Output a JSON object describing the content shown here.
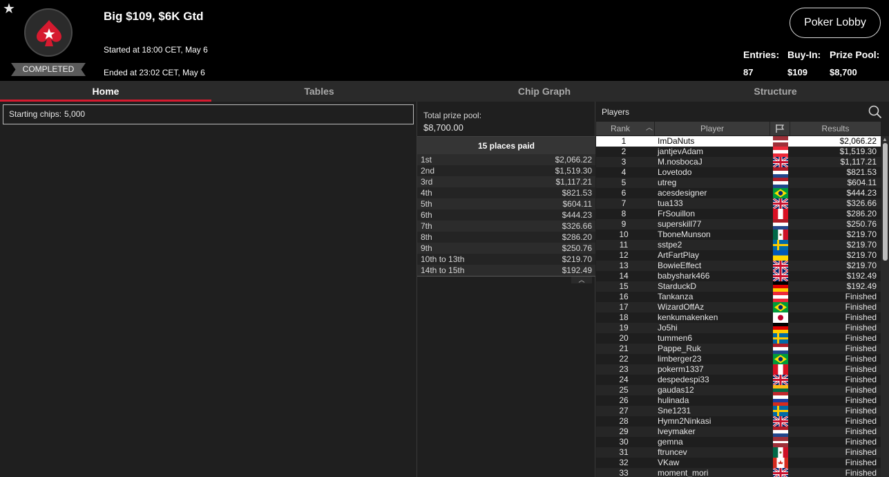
{
  "tournament": {
    "title": "Big $109, $6K Gtd",
    "started": "Started at 18:00 CET, May 6",
    "ended": "Ended at 23:02 CET, May 6",
    "status": "COMPLETED",
    "lobby_button": "Poker Lobby",
    "stats": {
      "entries_label": "Entries:",
      "entries": "87",
      "buyin_label": "Buy-In:",
      "buyin": "$109",
      "prizepool_label": "Prize Pool:",
      "prizepool": "$8,700"
    }
  },
  "tabs": [
    "Home",
    "Tables",
    "Chip Graph",
    "Structure"
  ],
  "active_tab": "Home",
  "home": {
    "starting_chips_label": "Starting chips:",
    "starting_chips": "5,000"
  },
  "prize": {
    "total_label": "Total prize pool:",
    "total_value": "$8,700.00",
    "places_paid": "15 places paid",
    "payouts": [
      {
        "place": "1st",
        "amount": "$2,066.22"
      },
      {
        "place": "2nd",
        "amount": "$1,519.30"
      },
      {
        "place": "3rd",
        "amount": "$1,117.21"
      },
      {
        "place": "4th",
        "amount": "$821.53"
      },
      {
        "place": "5th",
        "amount": "$604.11"
      },
      {
        "place": "6th",
        "amount": "$444.23"
      },
      {
        "place": "7th",
        "amount": "$326.66"
      },
      {
        "place": "8th",
        "amount": "$286.20"
      },
      {
        "place": "9th",
        "amount": "$250.76"
      },
      {
        "place": "10th to 13th",
        "amount": "$219.70"
      },
      {
        "place": "14th to 15th",
        "amount": "$192.49"
      }
    ]
  },
  "players": {
    "title": "Players",
    "columns": {
      "rank": "Rank",
      "player": "Player",
      "results": "Results"
    },
    "rows": [
      {
        "rank": "1",
        "name": "ImDaNuts",
        "flag": "latvia",
        "result": "$2,066.22"
      },
      {
        "rank": "2",
        "name": "jantjevAdam",
        "flag": "austria",
        "result": "$1,519.30"
      },
      {
        "rank": "3",
        "name": "M.nosbocaJ",
        "flag": "uk",
        "result": "$1,117.21"
      },
      {
        "rank": "4",
        "name": "Lovetodo",
        "flag": "netherlands",
        "result": "$821.53"
      },
      {
        "rank": "5",
        "name": "utreg",
        "flag": "netherlands",
        "result": "$604.11"
      },
      {
        "rank": "6",
        "name": "acesdesigner",
        "flag": "brazil",
        "result": "$444.23"
      },
      {
        "rank": "7",
        "name": "tua133",
        "flag": "uk",
        "result": "$326.66"
      },
      {
        "rank": "8",
        "name": "FrSouillon",
        "flag": "peru",
        "result": "$286.20"
      },
      {
        "rank": "9",
        "name": "superskill77",
        "flag": "netherlands",
        "result": "$250.76"
      },
      {
        "rank": "10",
        "name": "TboneMunson",
        "flag": "mexico",
        "result": "$219.70"
      },
      {
        "rank": "11",
        "name": "sstpe2",
        "flag": "sweden",
        "result": "$219.70"
      },
      {
        "rank": "12",
        "name": "ArtFartPlay",
        "flag": "ukraine",
        "result": "$219.70"
      },
      {
        "rank": "13",
        "name": "BowieEffect",
        "flag": "uk",
        "result": "$219.70"
      },
      {
        "rank": "14",
        "name": "babyshark466",
        "flag": "uk",
        "result": "$192.49"
      },
      {
        "rank": "15",
        "name": "StarduckD",
        "flag": "germany",
        "result": "$192.49"
      },
      {
        "rank": "16",
        "name": "Tankanza",
        "flag": "austria",
        "result": "Finished"
      },
      {
        "rank": "17",
        "name": "WizardOffAz",
        "flag": "brazil",
        "result": "Finished"
      },
      {
        "rank": "18",
        "name": "kenkumakenken",
        "flag": "japan",
        "result": "Finished"
      },
      {
        "rank": "19",
        "name": "Jo5hi",
        "flag": "germany",
        "result": "Finished"
      },
      {
        "rank": "20",
        "name": "tummen6",
        "flag": "sweden",
        "result": "Finished"
      },
      {
        "rank": "21",
        "name": "Pappe_Ruk",
        "flag": "netherlands",
        "result": "Finished"
      },
      {
        "rank": "22",
        "name": "limberger23",
        "flag": "brazil",
        "result": "Finished"
      },
      {
        "rank": "23",
        "name": "pokerm1337",
        "flag": "peru",
        "result": "Finished"
      },
      {
        "rank": "24",
        "name": "despedespi33",
        "flag": "uk",
        "result": "Finished"
      },
      {
        "rank": "25",
        "name": "gaudas12",
        "flag": "lithuania",
        "result": "Finished"
      },
      {
        "rank": "26",
        "name": "hulinada",
        "flag": "russia",
        "result": "Finished"
      },
      {
        "rank": "27",
        "name": "Sne1231",
        "flag": "sweden",
        "result": "Finished"
      },
      {
        "rank": "28",
        "name": "Hymn2Ninkasi",
        "flag": "uk",
        "result": "Finished"
      },
      {
        "rank": "29",
        "name": "lveymaker",
        "flag": "netherlands",
        "result": "Finished"
      },
      {
        "rank": "30",
        "name": "gemna",
        "flag": "latvia",
        "result": "Finished"
      },
      {
        "rank": "31",
        "name": "ftruncev",
        "flag": "mexico",
        "result": "Finished"
      },
      {
        "rank": "32",
        "name": "VKaw",
        "flag": "canada",
        "result": "Finished"
      },
      {
        "rank": "33",
        "name": "moment_mori",
        "flag": "uk",
        "result": "Finished"
      }
    ]
  },
  "colors": {
    "accent": "#d61a2f",
    "header_bg": "#000000",
    "panel_bg": "#1f1f1f",
    "selected_row": "#ffffff"
  }
}
